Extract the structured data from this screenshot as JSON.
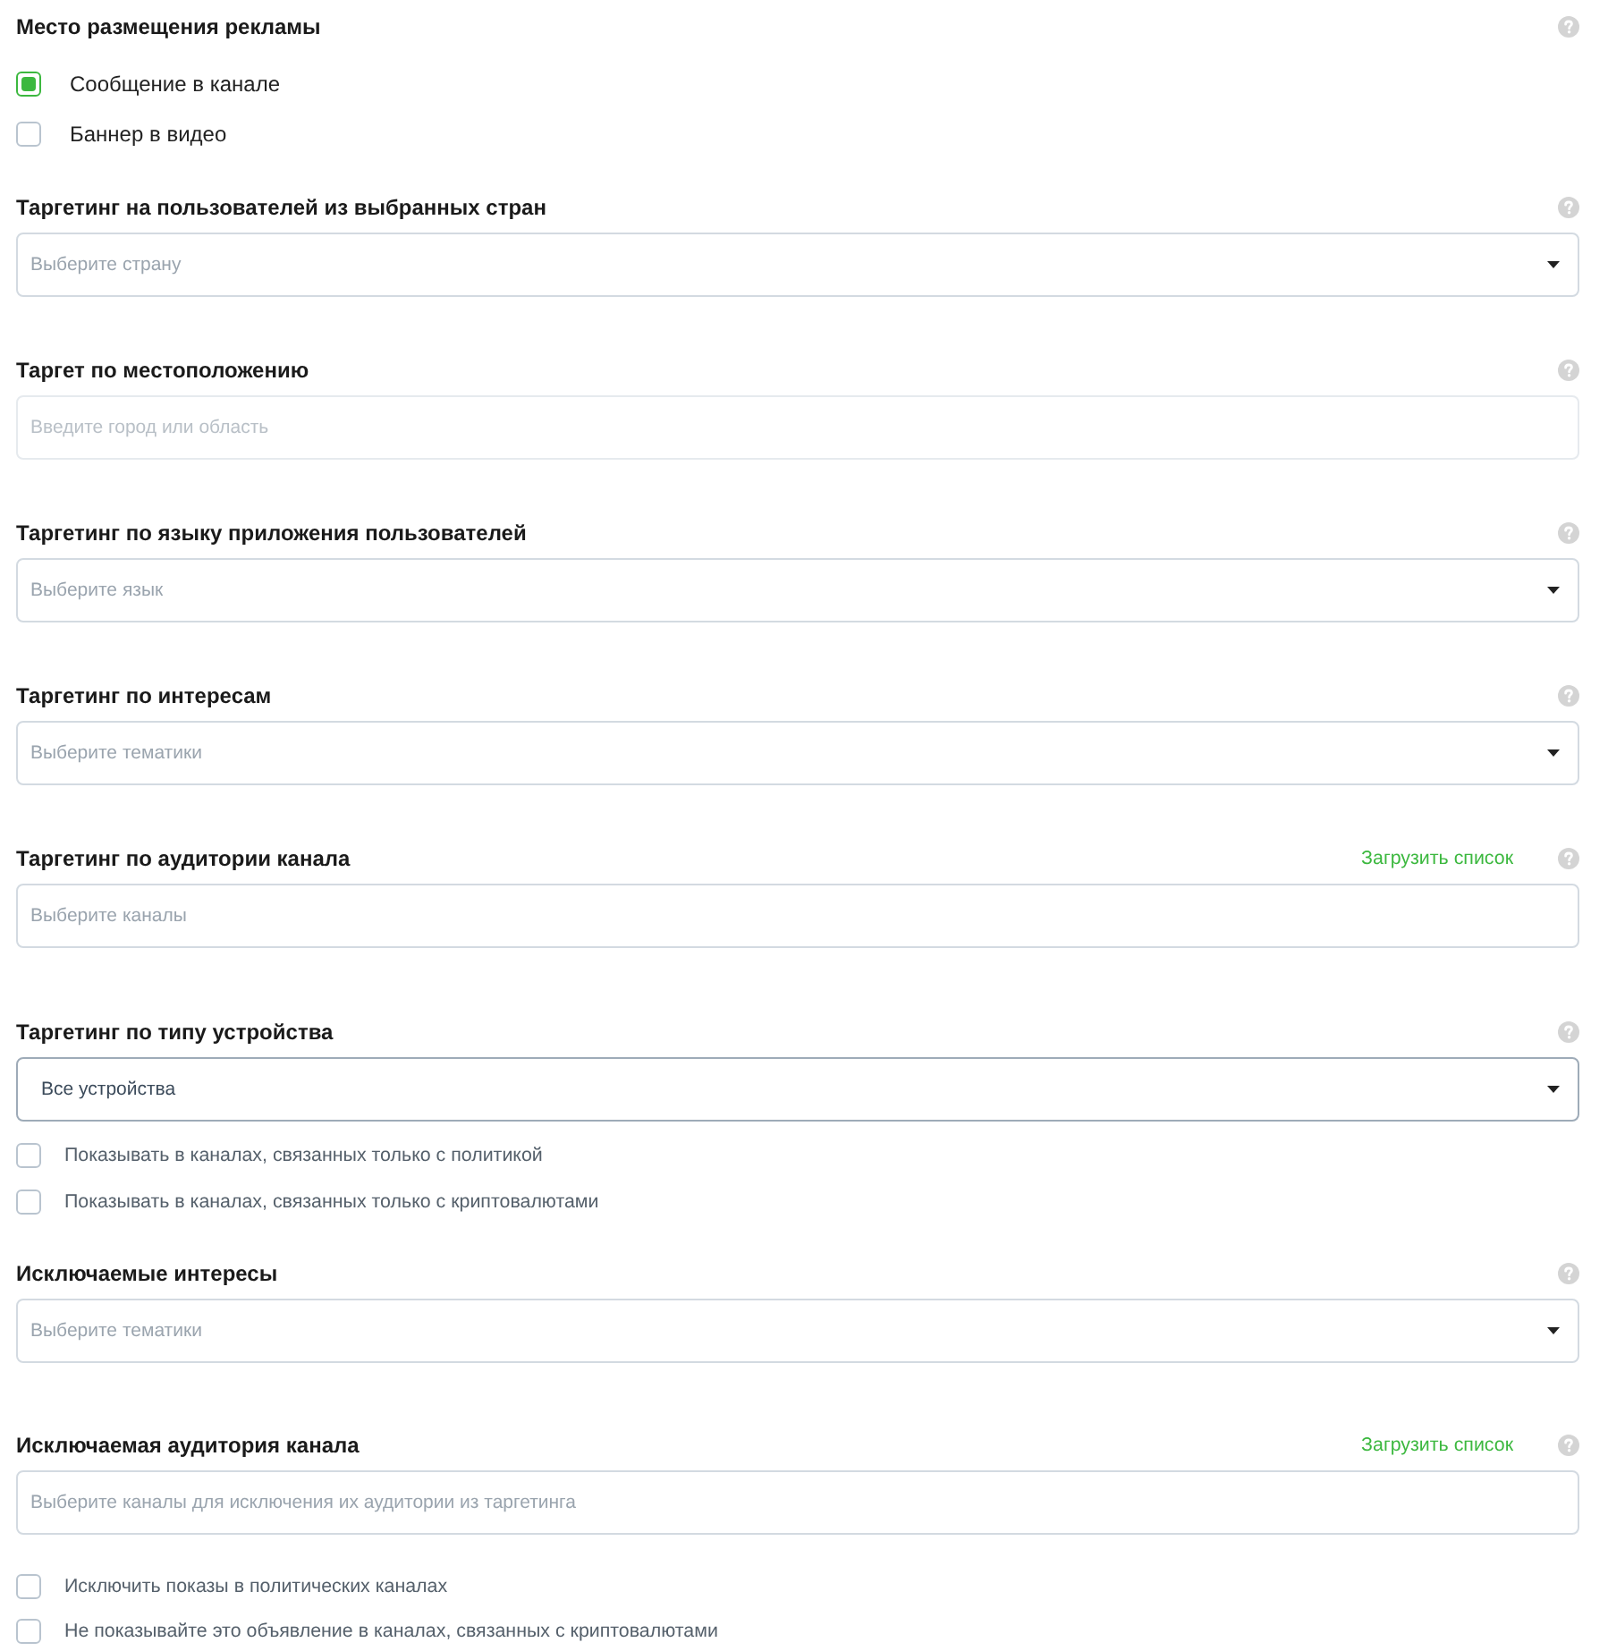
{
  "sections": [
    {
      "title": "Место размещения рекламы",
      "options": [
        {
          "label": "Сообщение в канале",
          "checked": true
        },
        {
          "label": "Баннер в видео",
          "checked": false
        }
      ]
    },
    {
      "title": "Таргетинг на пользователей из выбранных стран",
      "field": {
        "kind": "select",
        "placeholder": "Выберите страну",
        "disabled": false
      }
    },
    {
      "title": "Таргет по местоположению",
      "field": {
        "kind": "input",
        "placeholder": "Введите город или область",
        "disabled": true
      }
    },
    {
      "title": "Таргетинг по языку приложения пользователей",
      "field": {
        "kind": "select",
        "placeholder": "Выберите язык",
        "disabled": false
      }
    },
    {
      "title": "Таргетинг по интересам",
      "field": {
        "kind": "select",
        "placeholder": "Выберите тематики",
        "disabled": false
      }
    },
    {
      "title": "Таргетинг по аудитории канала",
      "action": "Загрузить список",
      "field": {
        "kind": "input",
        "placeholder": "Выберите каналы",
        "disabled": false
      }
    },
    {
      "title": "Таргетинг по типу устройства",
      "field": {
        "kind": "select",
        "value": "Все устройства",
        "disabled": false
      },
      "options": [
        {
          "label": "Показывать в каналах, связанных только с политикой",
          "checked": false
        },
        {
          "label": "Показывать в каналах, связанных только с криптовалютами",
          "checked": false
        }
      ]
    },
    {
      "title": "Исключаемые интересы",
      "field": {
        "kind": "select",
        "placeholder": "Выберите тематики",
        "disabled": false
      }
    },
    {
      "title": "Исключаемая аудитория канала",
      "action": "Загрузить список",
      "field": {
        "kind": "input",
        "placeholder": "Выберите каналы для исключения их аудитории из таргетинга",
        "disabled": false
      },
      "options": [
        {
          "label": "Исключить показы в политических каналах",
          "checked": false
        },
        {
          "label": "Не показывайте это объявление в каналах, связанных с криптовалютами",
          "checked": false
        }
      ]
    }
  ]
}
